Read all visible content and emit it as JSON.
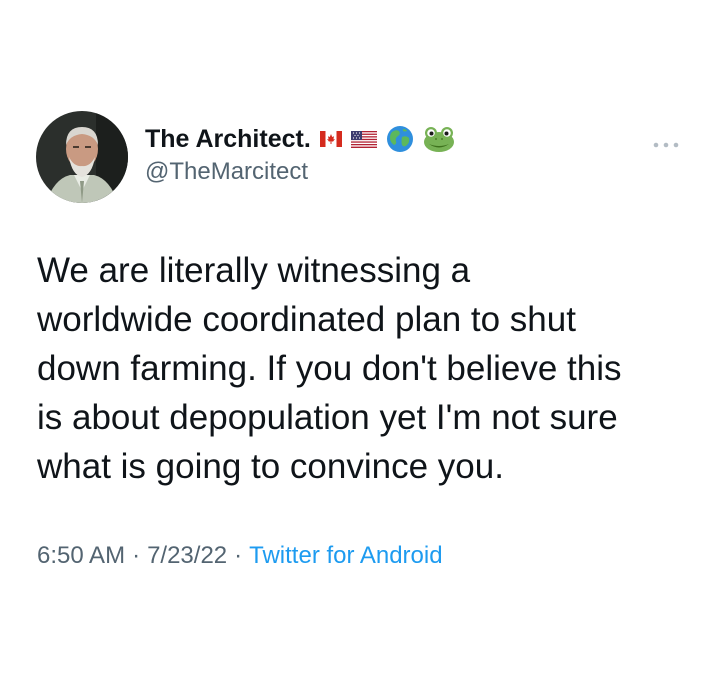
{
  "user": {
    "display_name": "The Architect.",
    "handle": "@TheMarcitect",
    "name_emojis": [
      "canada-flag-icon",
      "us-flag-icon",
      "globe-icon",
      "frog-icon"
    ]
  },
  "tweet": {
    "lines": [
      "We are literally witnessing a",
      "worldwide coordinated plan to shut",
      "down farming. If you don't believe this",
      "is about depopulation yet I'm not sure",
      "what is going to convince you."
    ],
    "time": "6:50 AM",
    "separator": "·",
    "date": "7/23/22",
    "source": "Twitter for Android"
  },
  "icons": {
    "more": "more-options-icon"
  },
  "colors": {
    "text": "#0f1419",
    "secondary": "#536471",
    "link": "#1d9bf0"
  }
}
